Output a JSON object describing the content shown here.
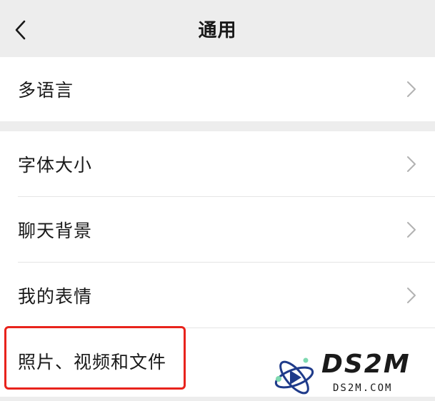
{
  "header": {
    "title": "通用",
    "back_icon": "chevron-left-icon"
  },
  "groups": [
    {
      "items": [
        {
          "label": "多语言"
        }
      ]
    },
    {
      "items": [
        {
          "label": "字体大小"
        },
        {
          "label": "聊天背景"
        },
        {
          "label": "我的表情"
        },
        {
          "label": "照片、视频和文件"
        }
      ]
    }
  ],
  "highlight": {
    "color": "#e8231c"
  },
  "watermark": {
    "brand": "DS2M",
    "site": "DS2M.COM"
  },
  "colors": {
    "background": "#ededed",
    "row": "#ffffff",
    "text": "#191919",
    "chevron": "#b2b2b2"
  }
}
